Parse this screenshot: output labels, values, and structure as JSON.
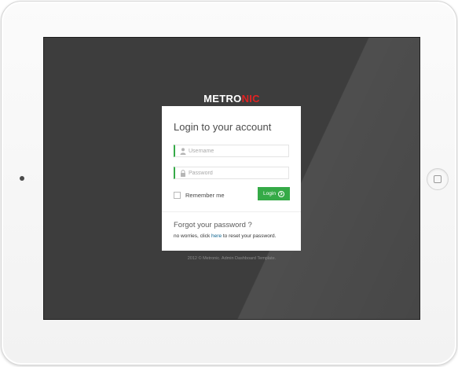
{
  "brand": {
    "part1": "METRO",
    "part2": "NIC",
    "accent_color": "#e02222"
  },
  "login": {
    "title": "Login to your account",
    "username_placeholder": "Username",
    "username_icon": "user-icon",
    "password_placeholder": "Password",
    "password_icon": "lock-icon",
    "remember_label": "Remember me",
    "button_label": "Login",
    "button_icon": "circle-arrow-right-icon",
    "button_color": "#35aa47"
  },
  "forgot": {
    "title": "Forgot your password ?",
    "text_before": "no worries, click ",
    "link": "here",
    "text_after": " to reset your password."
  },
  "footer": {
    "text": "2012 © Metronic. Admin Dashboard Template."
  }
}
